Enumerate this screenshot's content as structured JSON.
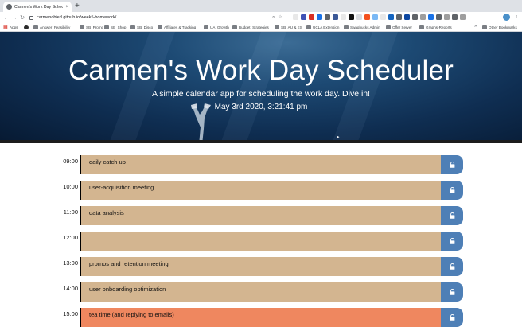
{
  "browser": {
    "tab_title": "Carmen's Work Day Scheduler",
    "tab_close": "×",
    "new_tab": "+",
    "url": "carmenobied.github.io/week5-homework/",
    "back": "←",
    "forward": "→",
    "reload": "↻",
    "bookmarks": [
      {
        "label": "Apps",
        "icon": "apps-grid-icon"
      },
      {
        "label": "",
        "icon": "github-icon"
      },
      {
        "label": "Answer_Feasibility",
        "icon": "folder-icon"
      },
      {
        "label": "SB_Promo",
        "icon": "folder-icon"
      },
      {
        "label": "SB_Shop",
        "icon": "folder-icon"
      },
      {
        "label": "SB_Disco",
        "icon": "folder-icon"
      },
      {
        "label": "Affiliates & Tracking",
        "icon": "folder-icon"
      },
      {
        "label": "UA_Growth",
        "icon": "folder-icon"
      },
      {
        "label": "Budget_Strategies",
        "icon": "folder-icon"
      },
      {
        "label": "SB_AU & ES",
        "icon": "folder-icon"
      },
      {
        "label": "UCLA Extension",
        "icon": "folder-icon"
      },
      {
        "label": "Swagbucks Admin",
        "icon": "link-icon"
      },
      {
        "label": "Offer Server",
        "icon": "link-icon"
      },
      {
        "label": "Graphs-Reports",
        "icon": "link-icon"
      },
      {
        "label": "Other Bookmarks",
        "icon": "folder-icon"
      }
    ],
    "bookmarks_more": "»"
  },
  "hero": {
    "title": "Carmen's Work Day Scheduler",
    "subtitle": "A simple calendar app for scheduling the work day. Dive in!",
    "current_date": "May 3rd 2020, 3:21:41 pm"
  },
  "schedule": {
    "hours": [
      {
        "hour": "09:00",
        "task": "daily catch up",
        "state": "past"
      },
      {
        "hour": "10:00",
        "task": "user-acquisition meeting",
        "state": "past"
      },
      {
        "hour": "11:00",
        "task": "data analysis",
        "state": "past"
      },
      {
        "hour": "12:00",
        "task": "",
        "state": "past"
      },
      {
        "hour": "13:00",
        "task": "promos and retention meeting",
        "state": "past"
      },
      {
        "hour": "14:00",
        "task": "user onboarding optimization",
        "state": "past"
      },
      {
        "hour": "15:00",
        "task": "tea time  (and replying to emails)",
        "state": "present"
      }
    ],
    "save_icon": "lock-icon"
  },
  "colors": {
    "past": "#d3b590",
    "present": "#ef875f",
    "save_button": "#4e7fb6",
    "hero_deep": "#0f2e52"
  }
}
